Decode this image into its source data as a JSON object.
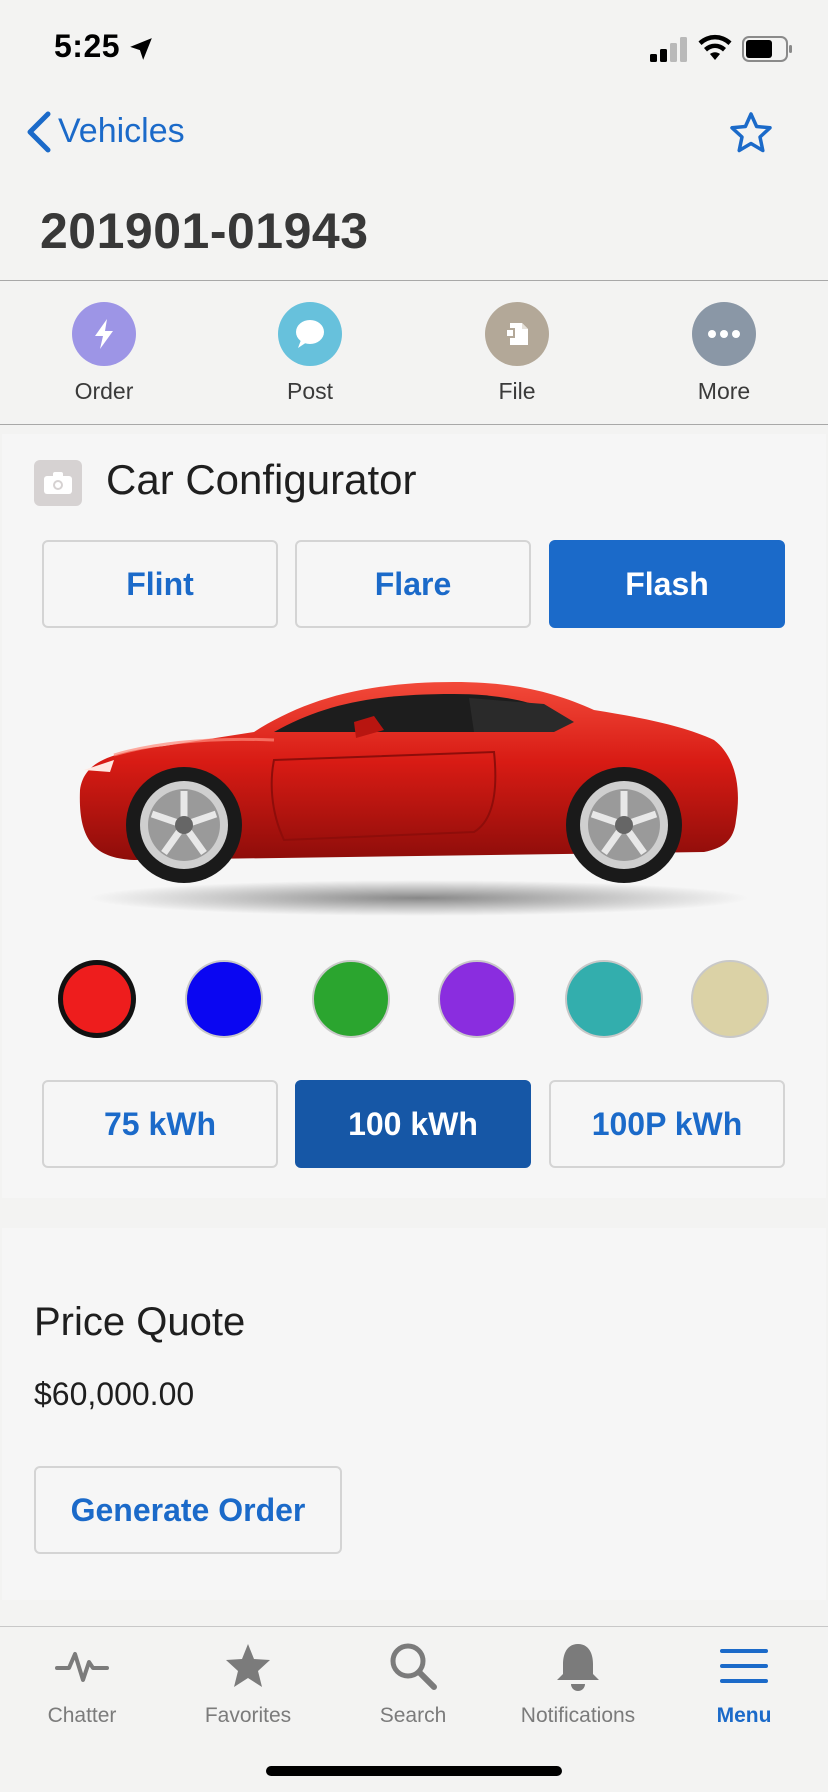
{
  "status": {
    "time": "5:25"
  },
  "nav": {
    "back_label": "Vehicles",
    "record_title": "201901-01943"
  },
  "actions": [
    {
      "label": "Order",
      "icon": "lightning-icon",
      "color": "#9d95e6"
    },
    {
      "label": "Post",
      "icon": "chat-bubble-icon",
      "color": "#67c1dc"
    },
    {
      "label": "File",
      "icon": "file-icon",
      "color": "#b3a898"
    },
    {
      "label": "More",
      "icon": "more-icon",
      "color": "#8a97a6"
    }
  ],
  "configurator": {
    "title": "Car Configurator",
    "models": [
      {
        "label": "Flint",
        "selected": false
      },
      {
        "label": "Flare",
        "selected": false
      },
      {
        "label": "Flash",
        "selected": true
      }
    ],
    "colors": [
      "#ee1d1d",
      "#0a06f2",
      "#2ba52f",
      "#8a2ddf",
      "#33aead",
      "#dbd2a6"
    ],
    "selected_color_index": 0,
    "batteries": [
      {
        "label": "75 kWh",
        "selected": false
      },
      {
        "label": "100 kWh",
        "selected": true
      },
      {
        "label": "100P kWh",
        "selected": false
      }
    ]
  },
  "quote": {
    "title": "Price Quote",
    "price": "$60,000.00",
    "button_label": "Generate Order"
  },
  "tabs": [
    {
      "label": "Chatter",
      "icon": "pulse-icon",
      "active": false
    },
    {
      "label": "Favorites",
      "icon": "star-icon",
      "active": false
    },
    {
      "label": "Search",
      "icon": "search-icon",
      "active": false
    },
    {
      "label": "Notifications",
      "icon": "bell-icon",
      "active": false
    },
    {
      "label": "Menu",
      "icon": "hamburger-icon",
      "active": true
    }
  ],
  "colors": {
    "accent": "#1b6ac9",
    "accent_dark": "#1657a6"
  }
}
